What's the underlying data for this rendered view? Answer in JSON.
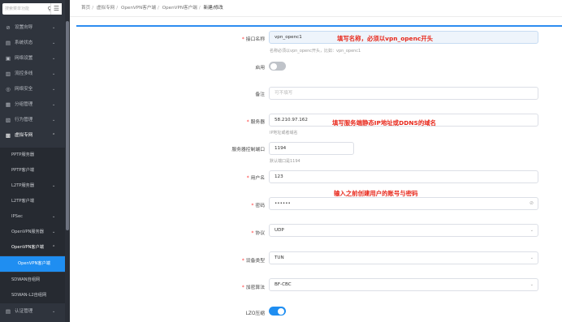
{
  "sidebar": {
    "search_placeholder": "搜索菜单功能",
    "menu": [
      {
        "label": "设置向导",
        "icon": "⊘"
      },
      {
        "label": "系统状态",
        "icon": "▤"
      },
      {
        "label": "网络设置",
        "icon": "▣"
      },
      {
        "label": "流控多线",
        "icon": "▥"
      },
      {
        "label": "网络安全",
        "icon": "◎"
      },
      {
        "label": "分组管理",
        "icon": "▦"
      },
      {
        "label": "行为管理",
        "icon": "▧"
      },
      {
        "label": "虚拟专网",
        "icon": "▩"
      }
    ],
    "vpn_submenu": [
      "PPTP服务器",
      "PPTP客户端",
      "L2TP服务器",
      "L2TP客户端",
      "IPSec",
      "OpenVPN服务器",
      "OpenVPN客户端"
    ],
    "openvpn_client_child": "OpenVPN客户端",
    "after_menu": [
      "SDWAN自组网",
      "SDWAN-L2自组网"
    ],
    "bottom_menu": {
      "label": "认证管理",
      "icon": "▤"
    }
  },
  "breadcrumb": [
    "首页",
    "虚拟专网",
    "OpenVPN客户端",
    "OpenVPN客户端",
    "新建/修改"
  ],
  "form": {
    "interface_name": {
      "label": "接口名称",
      "value": "vpn_openc1",
      "hint": "名称必须以vpn_openc开头，比如：vpn_openc1"
    },
    "enable": {
      "label": "启用"
    },
    "remark": {
      "label": "备注",
      "placeholder": "可不填写"
    },
    "server": {
      "label": "服务器",
      "value": "58.210.97.162",
      "hint": "IP地址或者域名"
    },
    "server_port": {
      "label": "服务器控制端口",
      "value": "1194",
      "hint": "默认端口是1194"
    },
    "username": {
      "label": "用户名",
      "value": "123"
    },
    "password": {
      "label": "密码",
      "value": "••••••"
    },
    "protocol": {
      "label": "协议",
      "value": "UDP"
    },
    "device_type": {
      "label": "设备类型",
      "value": "TUN"
    },
    "cipher": {
      "label": "加密算法",
      "value": "BF-CBC"
    },
    "lzo": {
      "label": "LZO压缩"
    }
  },
  "annotations": {
    "name_note": "填写名称，必须以vpn_openc开头",
    "server_note": "填写服务端静态IP地址或DDNS的域名",
    "account_note": "输入之前创建用户的账号与密码"
  },
  "colors": {
    "accent": "#1f8ef1",
    "note": "#e8281b",
    "sidebar": "#2f343d"
  }
}
